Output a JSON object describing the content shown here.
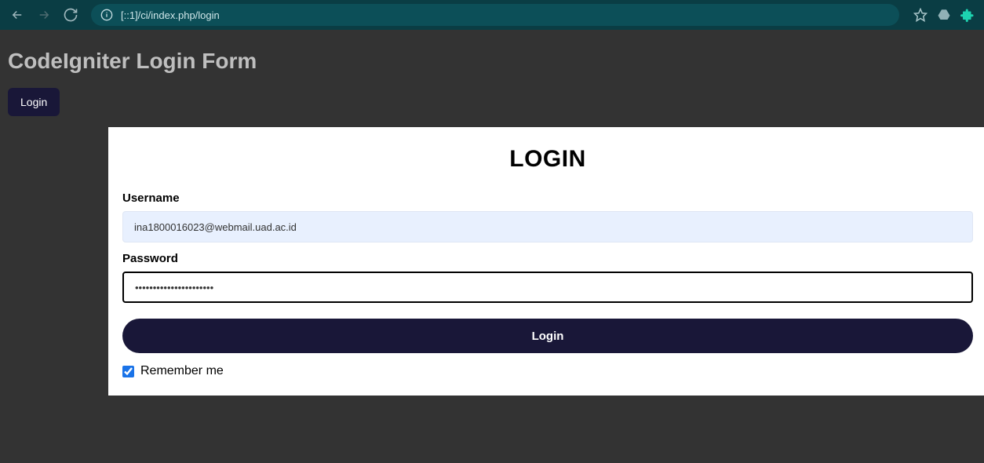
{
  "browser": {
    "url": "[::1]/ci/index.php/login"
  },
  "page": {
    "title": "CodeIgniter Login Form",
    "nav_login_label": "Login"
  },
  "loginForm": {
    "heading": "LOGIN",
    "usernameLabel": "Username",
    "usernameValue": "ina1800016023@webmail.uad.ac.id",
    "passwordLabel": "Password",
    "passwordValue": "••••••••••••••••••••••",
    "submitLabel": "Login",
    "rememberLabel": "Remember me",
    "rememberChecked": true
  }
}
